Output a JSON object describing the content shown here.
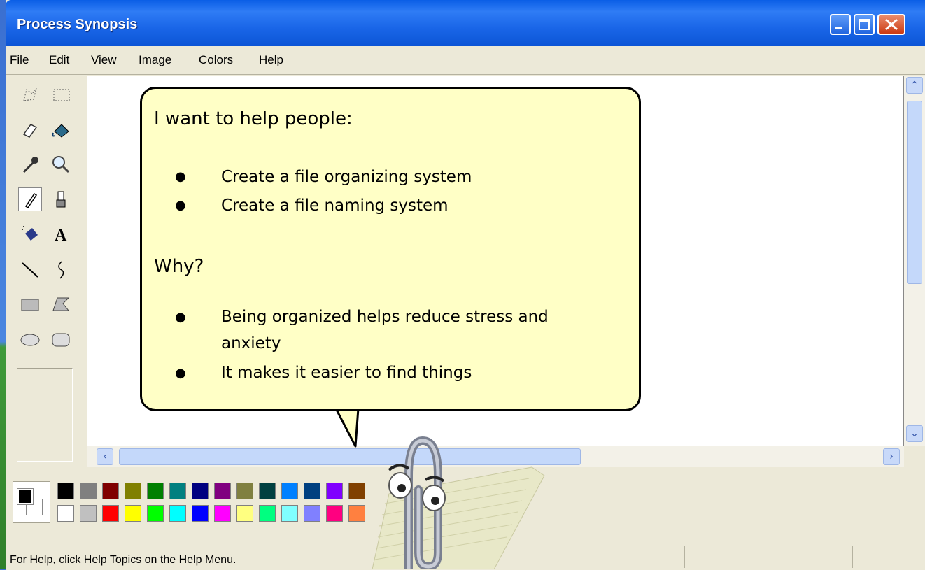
{
  "window": {
    "title": "Process Synopsis"
  },
  "menu": [
    "File",
    "Edit",
    "View",
    "Image",
    "Colors",
    "Help"
  ],
  "bubble": {
    "heading1": "I want to help people:",
    "list1": [
      "Create a file organizing system",
      "Create a file naming system"
    ],
    "heading2": "Why?",
    "list2_line1": "Being organized helps reduce stress and",
    "list2_line2": "anxiety",
    "list2_item2": "It makes it easier to find things"
  },
  "status": {
    "text": "For Help, click Help Topics on the Help Menu."
  },
  "palette": {
    "top_row": [
      "#000000",
      "#808080",
      "#800000",
      "#808000",
      "#008000",
      "#008080",
      "#000080",
      "#800080",
      "#808040",
      "#004040",
      "#0080ff",
      "#004080",
      "#8000ff",
      "#804000"
    ],
    "bottom_row": [
      "#ffffff",
      "#c0c0c0",
      "#ff0000",
      "#ffff00",
      "#00ff00",
      "#00ffff",
      "#0000ff",
      "#ff00ff",
      "#ffff80",
      "#00ff80",
      "#80ffff",
      "#8080ff",
      "#ff0080",
      "#ff8040"
    ],
    "foreground": "#000000",
    "background": "#ffffff"
  },
  "tools": [
    "free-form-select",
    "select",
    "eraser",
    "fill",
    "pick-color",
    "magnifier",
    "pencil",
    "brush",
    "airbrush",
    "text",
    "line",
    "curve",
    "rectangle",
    "polygon",
    "ellipse",
    "rounded-rectangle"
  ],
  "selected_tool": "pencil"
}
